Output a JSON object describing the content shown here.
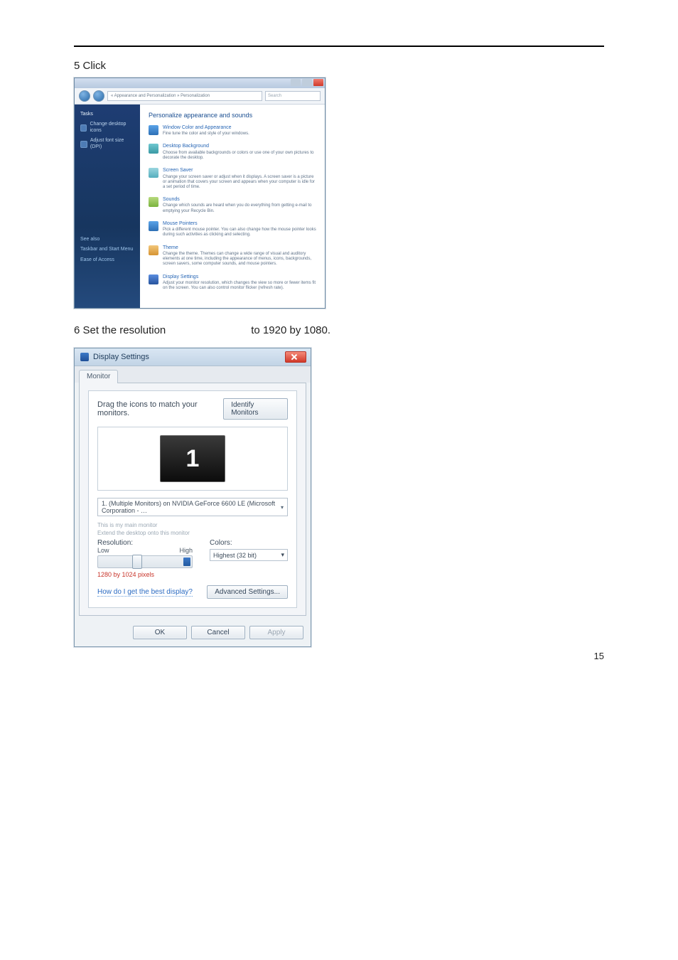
{
  "page": {
    "number": "15"
  },
  "step5": {
    "text": "5 Click"
  },
  "step6": {
    "text": "6 Set the resolution",
    "suffix": "to 1920 by 1080."
  },
  "win1": {
    "breadcrumb": "« Appearance and Personalization » Personalization",
    "searchPlaceholder": "Search",
    "side": {
      "header": "Tasks",
      "link1": "Change desktop icons",
      "link2": "Adjust font size (DPI)",
      "seeAlso": "See also",
      "sa1": "Taskbar and Start Menu",
      "sa2": "Ease of Access"
    },
    "title": "Personalize appearance and sounds",
    "items": [
      {
        "h": "Window Color and Appearance",
        "d": "Fine tune the color and style of your windows."
      },
      {
        "h": "Desktop Background",
        "d": "Choose from available backgrounds or colors or use one of your own pictures to decorate the desktop."
      },
      {
        "h": "Screen Saver",
        "d": "Change your screen saver or adjust when it displays. A screen saver is a picture or animation that covers your screen and appears when your computer is idle for a set period of time."
      },
      {
        "h": "Sounds",
        "d": "Change which sounds are heard when you do everything from getting e-mail to emptying your Recycle Bin."
      },
      {
        "h": "Mouse Pointers",
        "d": "Pick a different mouse pointer. You can also change how the mouse pointer looks during such activities as clicking and selecting."
      },
      {
        "h": "Theme",
        "d": "Change the theme. Themes can change a wide range of visual and auditory elements at one time, including the appearance of menus, icons, backgrounds, screen savers, some computer sounds, and mouse pointers."
      },
      {
        "h": "Display Settings",
        "d": "Adjust your monitor resolution, which changes the view so more or fewer items fit on the screen. You can also control monitor flicker (refresh rate)."
      }
    ]
  },
  "win2": {
    "title": "Display Settings",
    "tab": "Monitor",
    "dragLabel": "Drag the icons to match your monitors.",
    "identify": "Identify Monitors",
    "monitorNum": "1",
    "dropdown": "1. (Multiple Monitors) on NVIDIA GeForce 6600 LE (Microsoft Corporation - …",
    "chk1": "This is my main monitor",
    "chk2": "Extend the desktop onto this monitor",
    "resolutionHdr": "Resolution:",
    "low": "Low",
    "high": "High",
    "resText": "1280 by 1024 pixels",
    "colorsHdr": "Colors:",
    "colorsVal": "Highest (32 bit)",
    "helpLink": "How do I get the best display?",
    "advanced": "Advanced Settings...",
    "ok": "OK",
    "cancel": "Cancel",
    "apply": "Apply"
  }
}
